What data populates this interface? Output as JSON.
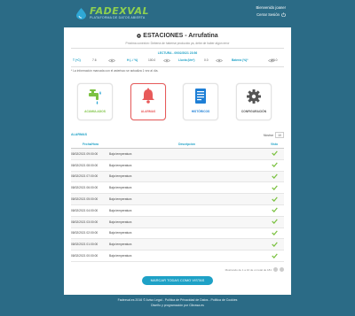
{
  "header": {
    "logo_text": "FADEXVAL",
    "logo_sub": "PLATAFORMA DE DATOS ABIERTA",
    "welcome": "Bienvenido joaner",
    "logout": "Cerrar Sesión"
  },
  "station": {
    "title": "ESTACIONES - Arrufatina",
    "subtitle": "Próxima conexión: Debería de haberse producido ya, debe de haber algún error",
    "last_reading_label": "LECTURA - 09/02/2021 23:56",
    "readings": [
      {
        "label": "T (ºC)",
        "value": "7.6"
      },
      {
        "label": "H (- / %)",
        "value": "100.0"
      },
      {
        "label": "Lluvia (l/m²)",
        "value": "0.0"
      },
      {
        "label": "Batería (%)*",
        "value": "90.0"
      }
    ],
    "note": "* La información marcada con el asterisco se actualiza 1 vez al día."
  },
  "tiles": [
    {
      "label": "ACUMULADOS",
      "color": "#7cc242"
    },
    {
      "label": "ALARMAS",
      "color": "#e85a5a"
    },
    {
      "label": "HISTÓRICOS",
      "color": "#1e7fd6"
    },
    {
      "label": "CONFIGURACIÓN",
      "color": "#555555"
    }
  ],
  "alarms": {
    "section_title": "ALARMAS",
    "show_label": "Mostrar",
    "show_value": "10",
    "columns": [
      "Fecha/Hora",
      "Descripción",
      "Visto"
    ],
    "rows": [
      {
        "date": "08/02/2021 09:00:00",
        "desc": "Baja temperatura"
      },
      {
        "date": "08/02/2021 08:00:00",
        "desc": "Baja temperatura"
      },
      {
        "date": "08/02/2021 07:00:00",
        "desc": "Baja temperatura"
      },
      {
        "date": "08/02/2021 06:00:00",
        "desc": "Baja temperatura"
      },
      {
        "date": "08/02/2021 05:00:00",
        "desc": "Baja temperatura"
      },
      {
        "date": "08/02/2021 04:00:00",
        "desc": "Baja temperatura"
      },
      {
        "date": "08/02/2021 03:00:00",
        "desc": "Baja temperatura"
      },
      {
        "date": "08/02/2021 02:00:00",
        "desc": "Baja temperatura"
      },
      {
        "date": "08/02/2021 01:00:00",
        "desc": "Baja temperatura"
      },
      {
        "date": "08/02/2021 00:00:00",
        "desc": "Baja temperatura"
      }
    ],
    "pager_text": "Mostrando de 1 a 10 de un total de 181",
    "mark_button": "MARCAR TODAS COMO VISTAS"
  },
  "footer": {
    "line1": "Fadexval.es 2016 © Aviso Legal - Política de Privacidad de Datos - Política de Cookies",
    "line2": "Diseño y programación por Cibrasa.es"
  },
  "colors": {
    "accent": "#1ea1c6",
    "header_bg": "#2b6b86",
    "check": "#7cc242"
  }
}
